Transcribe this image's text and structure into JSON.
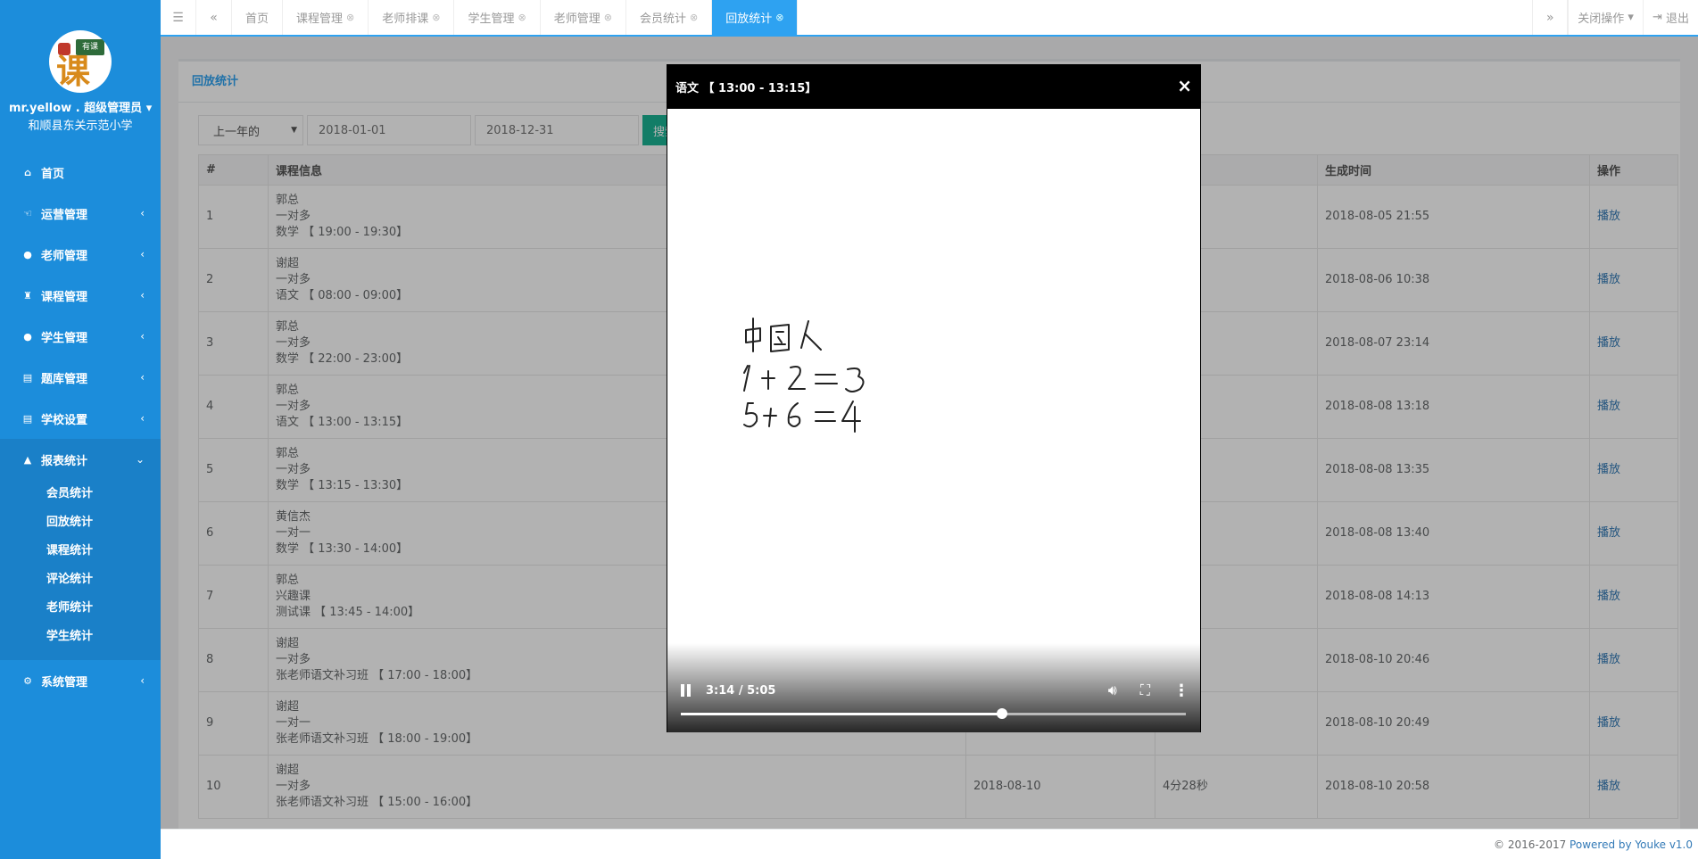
{
  "sidebar": {
    "user_name": "mr.yellow . 超级管理员",
    "school": "和顺县东关示范小学",
    "logo_board_text": "有课",
    "logo_char": "课",
    "items": [
      {
        "label": "首页",
        "icon": "home-icon",
        "glyph": "⌂"
      },
      {
        "label": "运营管理",
        "icon": "hand-icon",
        "glyph": "☜"
      },
      {
        "label": "老师管理",
        "icon": "user-icon",
        "glyph": "●"
      },
      {
        "label": "课程管理",
        "icon": "podium-icon",
        "glyph": "♜"
      },
      {
        "label": "学生管理",
        "icon": "user-icon",
        "glyph": "●"
      },
      {
        "label": "题库管理",
        "icon": "book-icon",
        "glyph": "▤"
      },
      {
        "label": "学校设置",
        "icon": "book-icon",
        "glyph": "▤"
      },
      {
        "label": "报表统计",
        "icon": "chart-icon",
        "glyph": "▲"
      }
    ],
    "report_sub": [
      "会员统计",
      "回放统计",
      "课程统计",
      "评论统计",
      "老师统计",
      "学生统计"
    ],
    "system": {
      "label": "系统管理",
      "icon": "gears-icon",
      "glyph": "⚙"
    }
  },
  "topbar": {
    "tabs": [
      {
        "label": "首页",
        "closable": false
      },
      {
        "label": "课程管理",
        "closable": true
      },
      {
        "label": "老师排课",
        "closable": true
      },
      {
        "label": "学生管理",
        "closable": true
      },
      {
        "label": "老师管理",
        "closable": true
      },
      {
        "label": "会员统计",
        "closable": true
      },
      {
        "label": "回放统计",
        "closable": true
      }
    ],
    "close_ops": "关闭操作",
    "logout": "退出"
  },
  "panel": {
    "title": "回放统计",
    "range_select": "上一年的",
    "start_date": "2018-01-01",
    "end_date": "2018-12-31",
    "search": "搜索"
  },
  "table": {
    "headers": [
      "#",
      "课程信息",
      "",
      "",
      "生成时间",
      "操作"
    ],
    "rows": [
      {
        "no": "1",
        "teacher": "郭总",
        "type": "一对多",
        "course": "数学 【 19:00 - 19:30】",
        "date": "",
        "duration": "",
        "created": "2018-08-05 21:55",
        "action": "播放"
      },
      {
        "no": "2",
        "teacher": "谢超",
        "type": "一对多",
        "course": "语文 【 08:00 - 09:00】",
        "date": "",
        "duration": "",
        "created": "2018-08-06 10:38",
        "action": "播放"
      },
      {
        "no": "3",
        "teacher": "郭总",
        "type": "一对多",
        "course": "数学 【 22:00 - 23:00】",
        "date": "",
        "duration": "",
        "created": "2018-08-07 23:14",
        "action": "播放"
      },
      {
        "no": "4",
        "teacher": "郭总",
        "type": "一对多",
        "course": "语文 【 13:00 - 13:15】",
        "date": "",
        "duration": "",
        "created": "2018-08-08 13:18",
        "action": "播放"
      },
      {
        "no": "5",
        "teacher": "郭总",
        "type": "一对多",
        "course": "数学 【 13:15 - 13:30】",
        "date": "",
        "duration": "",
        "created": "2018-08-08 13:35",
        "action": "播放"
      },
      {
        "no": "6",
        "teacher": "黄信杰",
        "type": "一对一",
        "course": "数学 【 13:30 - 14:00】",
        "date": "",
        "duration": "",
        "created": "2018-08-08 13:40",
        "action": "播放"
      },
      {
        "no": "7",
        "teacher": "郭总",
        "type": "兴趣课",
        "course": "测试课 【 13:45 - 14:00】",
        "date": "",
        "duration": "",
        "created": "2018-08-08 14:13",
        "action": "播放"
      },
      {
        "no": "8",
        "teacher": "谢超",
        "type": "一对多",
        "course": "张老师语文补习班 【 17:00 - 18:00】",
        "date": "",
        "duration": "",
        "created": "2018-08-10 20:46",
        "action": "播放"
      },
      {
        "no": "9",
        "teacher": "谢超",
        "type": "一对一",
        "course": "张老师语文补习班 【 18:00 - 19:00】",
        "date": "",
        "duration": "",
        "created": "2018-08-10 20:49",
        "action": "播放"
      },
      {
        "no": "10",
        "teacher": "谢超",
        "type": "一对多",
        "course": "张老师语文补习班 【 15:00 - 16:00】",
        "date": "2018-08-10",
        "duration": "4分28秒",
        "created": "2018-08-10 20:58",
        "action": "播放"
      }
    ]
  },
  "modal": {
    "title": "语文 【 13:00 - 13:15】",
    "close": "×",
    "time": "3:14 / 5:05",
    "progress": 0.636,
    "handwriting": [
      "中国人",
      "1+2=3",
      "5+6=4"
    ]
  },
  "footer": {
    "copyright": "© 2016-2017 ",
    "brand": "Powered by Youke v1.0"
  }
}
